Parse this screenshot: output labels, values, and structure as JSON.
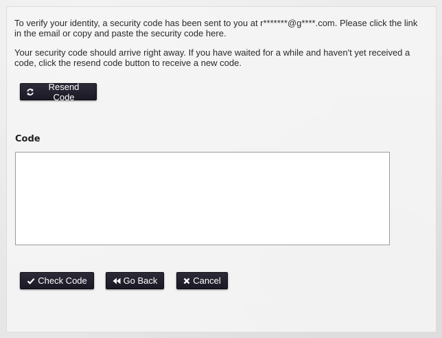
{
  "verification": {
    "message_sent": "To verify your identity, a security code has been sent to you at r*******@g****.com. Please click the link in the email or copy and paste the security code here.",
    "message_wait": "Your security code should arrive right away. If you have waited for a while and haven't yet received a code, click the resend code button to receive a new code."
  },
  "buttons": {
    "resend": {
      "label": "Resend Code",
      "icon": "refresh-icon"
    },
    "check": {
      "label": "Check Code",
      "icon": "checkmark-icon"
    },
    "back": {
      "label": "Go Back",
      "icon": "double-left-icon"
    },
    "cancel": {
      "label": "Cancel",
      "icon": "close-icon"
    }
  },
  "code_field": {
    "label": "Code",
    "value": ""
  },
  "colors": {
    "button_background": "#1f1e29",
    "button_text": "#ffffff",
    "panel_background": "#f5f5f5",
    "page_background": "#e9e9e9"
  }
}
